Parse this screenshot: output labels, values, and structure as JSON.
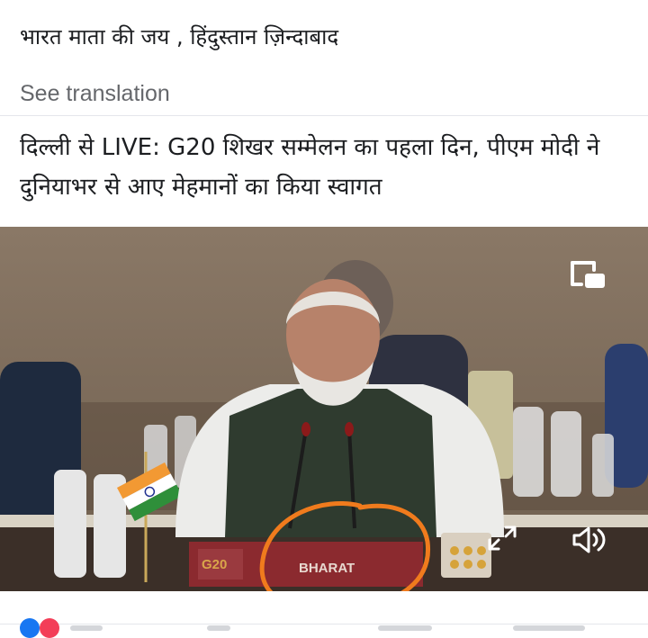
{
  "post": {
    "text": "भारत माता की जय , हिंदुस्तान ज़िन्दाबाद",
    "see_translation": "See translation"
  },
  "article": {
    "headline": "दिल्ली से LIVE: G20 शिखर सम्मेलन का पहला दिन, पीएम मोदी ने दुनियाभर से आए मेहमानों का किया स्वागत"
  },
  "video": {
    "nameplate_text": "BHARAT",
    "logo_text": "G20",
    "controls": {
      "pip_icon": "picture-in-picture-icon",
      "expand_icon": "expand-icon",
      "mute_icon": "speaker-mute-icon"
    },
    "annotation_color": "#f07b1d"
  },
  "colors": {
    "text": "#1c1e21",
    "muted": "#65676b",
    "divider": "#e4e6eb"
  }
}
